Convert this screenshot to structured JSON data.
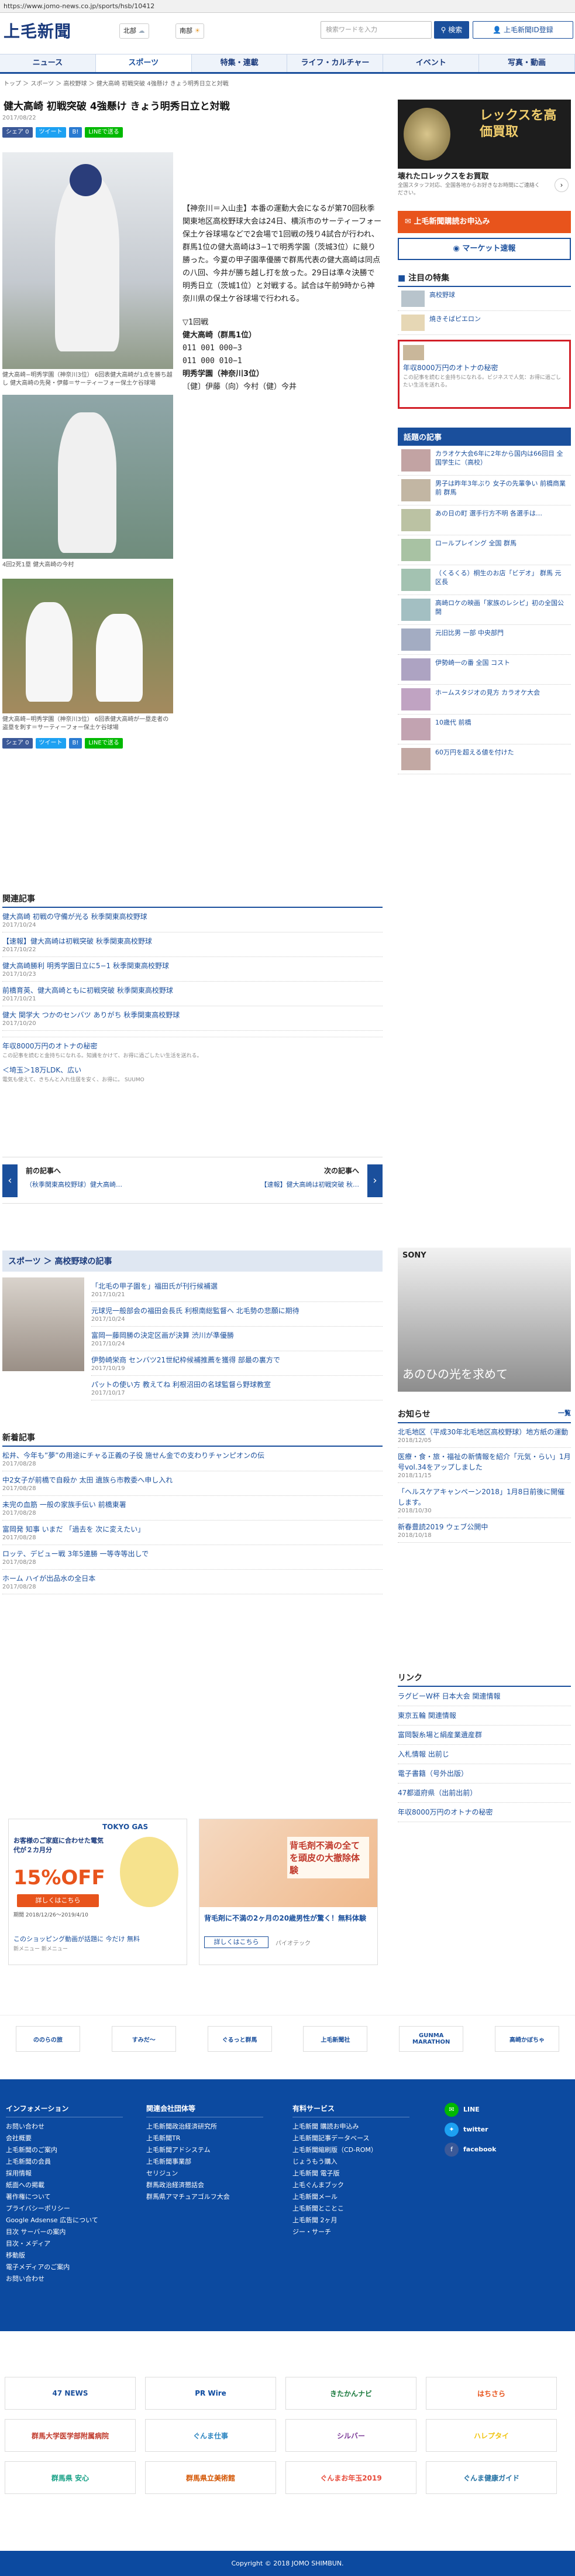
{
  "browser": {
    "url": "https://www.jomo-news.co.jp/sports/hsb/10412"
  },
  "header": {
    "logo": "上毛新聞",
    "loc1": "北部",
    "loc2": "南部",
    "search_placeholder": "検索ワードを入力",
    "search_label": "検索",
    "subscribe_label": "上毛新聞ID登録"
  },
  "nav": [
    "ニュース",
    "スポーツ",
    "特集・連載",
    "ライフ・カルチャー",
    "イベント",
    "写真・動画"
  ],
  "breadcrumb": "トップ ＞ スポーツ ＞ 高校野球 ＞ 健大高崎 初戦突破 4強懸け きょう明秀日立と対戦",
  "article": {
    "title": "健大高崎 初戦突破 4強懸け きょう明秀日立と対戦",
    "date": "2017/08/22",
    "share": [
      "シェア 0",
      "ツイート",
      "B!",
      "LINEで送る"
    ],
    "text": "【神奈川＝入山圭】本番の運動大会になるが第70回秋季関東地区高校野球大会は24日、横浜市のサーティーフォー保土ケ谷球場などで2会場で1回戦の残り4試合が行われ、群馬1位の健大高崎は3−1で明秀学園（茨城3位）に競り勝った。今夏の甲子園準優勝で群馬代表の健大高崎は同点の八回、今井が勝ち越し打を放った。29日は準々決勝で明秀日立（茨城1位）と対戦する。試合は午前9時から神奈川県の保土ケ谷球場で行われる。",
    "score_title": "▽1回戦",
    "score": [
      "健大高崎（群馬1位）",
      "011 001 000−3",
      "011 000 010−1",
      "明秀学園（神奈川3位）",
      "〔健〕伊藤（向）今村（健）今井"
    ],
    "cap1": "健大高崎−明秀学園（神奈川3位） 6回表健大高崎が1点を勝ち越し 健大高崎の先発・伊藤＝サーティーフォー保土ケ谷球場",
    "cap2": "4回2死1塁 健大高崎の今村",
    "cap3": "健大高崎−明秀学園（神奈川3位） 6回表健大高崎が一塁走者の盗塁を刺す＝サーティーフォー保土ケ谷球場"
  },
  "related": {
    "heading": "関連記事",
    "items": [
      {
        "t": "健大高崎 初戦の守備が光る 秋季関東高校野球",
        "d": "2017/10/24"
      },
      {
        "t": "【速報】健大高崎は初戦突破 秋季関東高校野球",
        "d": "2017/10/22"
      },
      {
        "t": "健大高崎勝利 明秀学園日立に5−1 秋季関東高校野球",
        "d": "2017/10/23"
      },
      {
        "t": "前橋育英、健大高崎ともに初戦突破 秋季関東高校野球",
        "d": "2017/10/21"
      },
      {
        "t": "健大 関学大 つかのセンバツ ありがち 秋季関東高校野球",
        "d": "2017/10/20"
      }
    ],
    "promo": "年収8000万円のオトナの秘密",
    "promo_sub": "この記事を読むと金持ちになれる。知識をかけて、お得に過ごしたい生活を送れる。",
    "promo2": "＜埼玉＞18万LDK、広い",
    "promo2_sub": "電気も使えて、きちんと入れ住居を安く、お得に。 SUUMO"
  },
  "pager": {
    "prev_label": "前の記事へ",
    "prev_text": "（秋季関東高校野球）健大高崎…",
    "next_label": "次の記事へ",
    "next_text": "【速報】健大高崎は初戦突破 秋…"
  },
  "hsb": {
    "heading": "スポーツ ＞ 高校野球の記事",
    "items": [
      {
        "t": "「北毛の甲子園を」福田氏が刊行候補選",
        "d": "2017/10/21"
      },
      {
        "t": "元球児一般部会の福田会長氏 利根南総監督へ 北毛勢の悲願に期待",
        "d": "2017/10/24"
      },
      {
        "t": "富岡一藤岡勝の決定区画が決算 渋川が準優勝",
        "d": "2017/10/24"
      },
      {
        "t": "伊勢崎栄商 センバツ21世紀枠候補推薦を獲得 部最の裏方で",
        "d": "2017/10/19"
      },
      {
        "t": "パットの使い方 教えてね 利根沼田の名球監督ら野球教室",
        "d": "2017/10/17"
      }
    ]
  },
  "latest": {
    "heading": "新着記事",
    "items": [
      {
        "t": "松井、今年も”夢”の用途にチャる正義の子役 施せん金での支わりチャンピオンの伝",
        "d": "2017/08/28"
      },
      {
        "t": "中2女子が前橋で自殺か 太田 遺族ら市教委へ申し入れ",
        "d": "2017/08/28"
      },
      {
        "t": "未完の血筋 一般の家族手伝い 前橋東署",
        "d": "2017/08/28"
      },
      {
        "t": "富岡発 知事 いまだ 「過去を 次に変えたい」",
        "d": "2017/08/28"
      },
      {
        "t": "ロッテ、デビュー戦 3年5連勝 一等寺等出しで",
        "d": "2017/08/28"
      },
      {
        "t": "ホーム ハイが出品水の全日本",
        "d": "2017/08/28"
      }
    ]
  },
  "sidebar": {
    "ad_top_title": "レックスを高価買取",
    "ad_top_sub": "壊れたロレックスをお買取",
    "ad_top_desc": "全国スタッフ対応、全国各地からお好きなお時間にご連絡ください。",
    "subscribe": "上毛新聞購読お申込み",
    "market": "マーケット速報",
    "featured_heading": "注目の特集",
    "featured": [
      "高校野球",
      "焼きそばピエロン"
    ],
    "featured_ad": "年収8000万円のオトナの秘密",
    "featured_ad_sub": "この記事を読むと金持ちになれる。ビジネスで人気：お得に過ごしたい生活を送れる。",
    "popular_heading": "話題の記事",
    "popular": [
      "カラオケ大会6年に2年から国内は66回目 全国学生に（高校）",
      "男子は昨年3年ぶり 女子の先輩争い 前橋商業前 群馬",
      "あの日の町 選手行方不明 各選手は…",
      "ロールプレイング 全国 群馬",
      "（くるくる）桐生のお店「ビデオ」 群馬 元区長",
      "高崎ロケの映画「家族のレシピ」初の全国公開",
      "元旧比男 一部 中央部門",
      "伊勢崎一の番 全国 コスト",
      "ホームスタジオの見方 カラオケ大会",
      "10歳代 前橋",
      "60万円を超える値を付けた"
    ],
    "ad_sony_t": "SONY",
    "ad_sony_c": "あのひの光を求めて",
    "notice_heading": "お知らせ",
    "notice_more": "一覧",
    "notices": [
      {
        "t": "北毛地区（平成30年北毛地区高校野球）地方紙の運動",
        "d": "2018/12/05"
      },
      {
        "t": "医療・食・旅・福祉の新情報を紹介「元気・らい」1月号vol.34をアップしました",
        "d": "2018/11/15"
      },
      {
        "t": "「ヘルスケアキャンペーン2018」1月8日前後に開催します。",
        "d": "2018/10/30"
      },
      {
        "t": "新春豊読2019 ウェブ公開中",
        "d": "2018/10/18"
      }
    ],
    "links_heading": "リンク",
    "links": [
      "ラグビーW杯 日本大会 関連情報",
      "東京五輪 関連情報",
      "富岡製糸場と絹産業遺産群",
      "入札情報 出前じ",
      "電子書籍（号外出版）",
      "47都道府県（出前出前）",
      "年収8000万円のオトナの秘密"
    ]
  },
  "bottom_ads": {
    "gas_brand": "TOKYO GAS",
    "gas_off": "15%OFF",
    "gas_cta": "詳しくはこちら",
    "gas_headline": "お客様のご家庭に合わせた電気代が２カ月分",
    "gas_period": "期間 2018/12/26〜2019/4/10",
    "gas_promo": "このショッピング動画が話題に 今だけ 無料",
    "gas_promo_sub": "新メニュー 新メニュー",
    "pack_headline": "背毛剤に不満の2ヶ月の20歳男性が驚く！無料体験",
    "pack_cta": "詳しくはこちら",
    "pack_brand": "パイオテック",
    "pack_catch": "背毛剤不満の全てを頭皮の大撤除体験"
  },
  "partner_banners": [
    "ののらの旅",
    "すみだ〜",
    "ぐるっと群馬",
    "上毛新聞社",
    "GUNMA MARATHON",
    "高崎かぼちゃ"
  ],
  "footer": {
    "info_heading": "インフォメーション",
    "info": [
      "お問い合わせ",
      "会社概要",
      "上毛新聞のご案内",
      "上毛新聞の会員",
      "採用情報",
      "紙面への掲載",
      "著作権について",
      "プライバシーポリシー",
      "Google Adsense 広告について",
      "目次 サーバーの案内",
      "目次・メディア",
      "移動版",
      "電子メディアのご案内",
      "お問い合わせ"
    ],
    "group_heading": "関連会社団体等",
    "group": [
      "上毛新聞政治経済研究所",
      "上毛新聞TR",
      "上毛新聞アドシステム",
      "上毛新聞事業部",
      "セリジュン",
      "群馬政治経済懇話会",
      "群馬県アマチュアゴルフ大会"
    ],
    "paid_heading": "有料サービス",
    "paid": [
      "上毛新聞 購読お申込み",
      "上毛新聞記事データベース",
      "上毛新聞縮刷版（CD-ROM）",
      "じょうもう購入",
      "上毛新聞 電子版",
      "上毛ぐんまブック",
      "上毛新聞メール",
      "上毛新聞とことこ",
      "上毛新聞 2ヶ月",
      "ジー・サーチ"
    ],
    "social": [
      "LINE",
      "twitter",
      "facebook"
    ],
    "copyright": "Copyright © 2018 JOMO SHIMBUN."
  },
  "footer_banners": [
    "47 NEWS",
    "PR Wire",
    "きたかんナビ",
    "はちさら",
    "群馬大学医学部附属病院",
    "ぐんま仕事",
    "シルバー",
    "ハレプタイ",
    "群馬県 安心",
    "群馬県立美術館",
    "ぐんまお年玉2019",
    "ぐんま健康ガイド"
  ]
}
